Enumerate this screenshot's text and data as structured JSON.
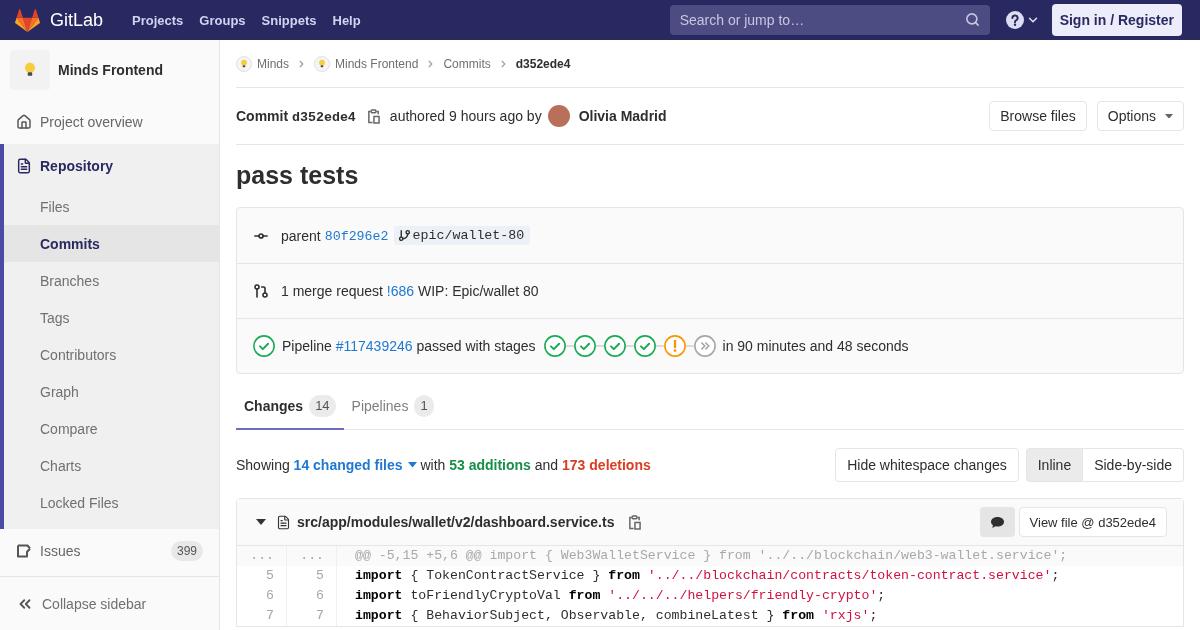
{
  "header": {
    "logo_text": "GitLab",
    "nav": [
      {
        "label": "Projects"
      },
      {
        "label": "Groups"
      },
      {
        "label": "Snippets"
      },
      {
        "label": "Help"
      }
    ],
    "search": {
      "placeholder": "Search or jump to…"
    },
    "sign_in": "Sign in / Register"
  },
  "sidebar": {
    "project": "Minds Frontend",
    "items": [
      {
        "label": "Project overview",
        "kind": "overview",
        "selected": false
      },
      {
        "label": "Repository",
        "kind": "repository",
        "selected": true,
        "children": [
          {
            "label": "Files",
            "selected": false
          },
          {
            "label": "Commits",
            "selected": true
          },
          {
            "label": "Branches",
            "selected": false
          },
          {
            "label": "Tags",
            "selected": false
          },
          {
            "label": "Contributors",
            "selected": false
          },
          {
            "label": "Graph",
            "selected": false
          },
          {
            "label": "Compare",
            "selected": false
          },
          {
            "label": "Charts",
            "selected": false
          },
          {
            "label": "Locked Files",
            "selected": false
          }
        ]
      },
      {
        "label": "Issues",
        "kind": "issues",
        "selected": false,
        "badge": "399"
      }
    ],
    "collapse": "Collapse sidebar"
  },
  "breadcrumbs": [
    {
      "label": "Minds",
      "kind": "group"
    },
    {
      "label": "Minds Frontend",
      "kind": "project"
    },
    {
      "label": "Commits",
      "kind": "link"
    },
    {
      "label": "d352ede4",
      "kind": "current"
    }
  ],
  "commit": {
    "label": "Commit",
    "sha": "d352ede4",
    "authored": "authored 9 hours ago by",
    "author": "Olivia Madrid",
    "browse": "Browse files",
    "options": "Options"
  },
  "title": "pass tests",
  "info": {
    "parent": {
      "label": "parent",
      "sha": "80f296e2",
      "branch": "epic/wallet-80"
    },
    "merge_request": {
      "count": "1 merge request",
      "link": "!686",
      "title": "WIP: Epic/wallet 80"
    },
    "pipeline": {
      "kind": "success",
      "label": "Pipeline",
      "link": "#117439246",
      "text": "passed with stages",
      "stages": [
        {
          "kind": "success"
        },
        {
          "kind": "success"
        },
        {
          "kind": "success"
        },
        {
          "kind": "success"
        },
        {
          "kind": "warning"
        },
        {
          "kind": "skipped"
        }
      ],
      "duration": "in 90 minutes and 48 seconds"
    }
  },
  "tabs": [
    {
      "label": "Changes",
      "count": "14",
      "selected": true
    },
    {
      "label": "Pipelines",
      "count": "1",
      "selected": false
    }
  ],
  "summary": {
    "showing": "Showing",
    "files": "14 changed files",
    "with": "with",
    "additions": "53 additions",
    "and": "and",
    "deletions": "173 deletions"
  },
  "toolbar": {
    "whitespace": "Hide whitespace changes",
    "modes": [
      {
        "label": "Inline",
        "selected": true
      },
      {
        "label": "Side-by-side",
        "selected": false
      }
    ]
  },
  "file": {
    "path": "src/app/modules/wallet/v2/dashboard.service.ts",
    "expanded": true,
    "view_file": "View file @ d352ede4",
    "lines": [
      {
        "kind": "match",
        "old": "...",
        "new": "...",
        "text": "@@ -5,15 +5,6 @@ import { Web3WalletService } from '../../blockchain/web3-wallet.service';"
      },
      {
        "kind": "context",
        "old": "5",
        "new": "5",
        "tokens": [
          {
            "kind": "keyword",
            "text": "import"
          },
          {
            "kind": "plain",
            "text": " { TokenContractService } "
          },
          {
            "kind": "keyword",
            "text": "from"
          },
          {
            "kind": "string",
            "text": " '../../blockchain/contracts/token-contract.service'"
          },
          {
            "kind": "plain",
            "text": ";"
          }
        ]
      },
      {
        "kind": "context",
        "old": "6",
        "new": "6",
        "tokens": [
          {
            "kind": "keyword",
            "text": "import"
          },
          {
            "kind": "plain",
            "text": " toFriendlyCryptoVal "
          },
          {
            "kind": "keyword",
            "text": "from"
          },
          {
            "kind": "string",
            "text": " '../../../helpers/friendly-crypto'"
          },
          {
            "kind": "plain",
            "text": ";"
          }
        ]
      },
      {
        "kind": "context",
        "old": "7",
        "new": "7",
        "tokens": [
          {
            "kind": "keyword",
            "text": "import"
          },
          {
            "kind": "plain",
            "text": " { BehaviorSubject, Observable, combineLatest } "
          },
          {
            "kind": "keyword",
            "text": "from"
          },
          {
            "kind": "string",
            "text": " 'rxjs'"
          },
          {
            "kind": "plain",
            "text": ";"
          }
        ]
      }
    ]
  }
}
